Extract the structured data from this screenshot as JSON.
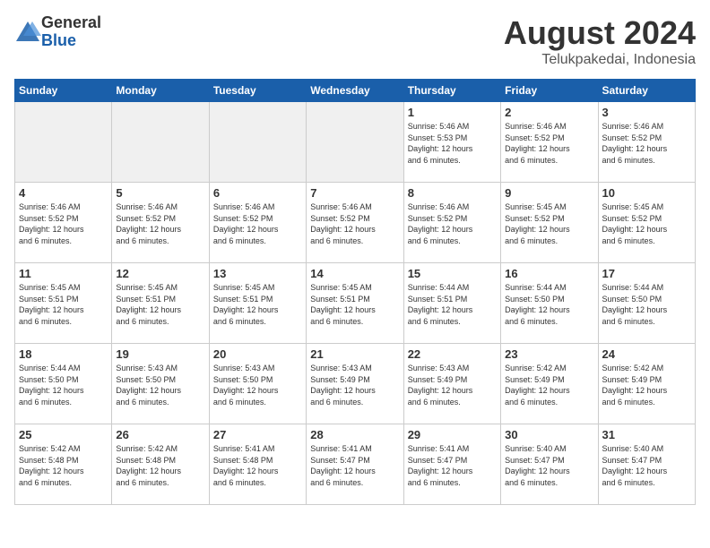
{
  "header": {
    "logo_general": "General",
    "logo_blue": "Blue",
    "title": "August 2024",
    "location": "Telukpakedai, Indonesia"
  },
  "days_of_week": [
    "Sunday",
    "Monday",
    "Tuesday",
    "Wednesday",
    "Thursday",
    "Friday",
    "Saturday"
  ],
  "weeks": [
    [
      {
        "day": "",
        "info": "",
        "shaded": true
      },
      {
        "day": "",
        "info": "",
        "shaded": true
      },
      {
        "day": "",
        "info": "",
        "shaded": true
      },
      {
        "day": "",
        "info": "",
        "shaded": true
      },
      {
        "day": "1",
        "info": "Sunrise: 5:46 AM\nSunset: 5:53 PM\nDaylight: 12 hours\nand 6 minutes."
      },
      {
        "day": "2",
        "info": "Sunrise: 5:46 AM\nSunset: 5:52 PM\nDaylight: 12 hours\nand 6 minutes."
      },
      {
        "day": "3",
        "info": "Sunrise: 5:46 AM\nSunset: 5:52 PM\nDaylight: 12 hours\nand 6 minutes."
      }
    ],
    [
      {
        "day": "4",
        "info": "Sunrise: 5:46 AM\nSunset: 5:52 PM\nDaylight: 12 hours\nand 6 minutes."
      },
      {
        "day": "5",
        "info": "Sunrise: 5:46 AM\nSunset: 5:52 PM\nDaylight: 12 hours\nand 6 minutes."
      },
      {
        "day": "6",
        "info": "Sunrise: 5:46 AM\nSunset: 5:52 PM\nDaylight: 12 hours\nand 6 minutes."
      },
      {
        "day": "7",
        "info": "Sunrise: 5:46 AM\nSunset: 5:52 PM\nDaylight: 12 hours\nand 6 minutes."
      },
      {
        "day": "8",
        "info": "Sunrise: 5:46 AM\nSunset: 5:52 PM\nDaylight: 12 hours\nand 6 minutes."
      },
      {
        "day": "9",
        "info": "Sunrise: 5:45 AM\nSunset: 5:52 PM\nDaylight: 12 hours\nand 6 minutes."
      },
      {
        "day": "10",
        "info": "Sunrise: 5:45 AM\nSunset: 5:52 PM\nDaylight: 12 hours\nand 6 minutes."
      }
    ],
    [
      {
        "day": "11",
        "info": "Sunrise: 5:45 AM\nSunset: 5:51 PM\nDaylight: 12 hours\nand 6 minutes."
      },
      {
        "day": "12",
        "info": "Sunrise: 5:45 AM\nSunset: 5:51 PM\nDaylight: 12 hours\nand 6 minutes."
      },
      {
        "day": "13",
        "info": "Sunrise: 5:45 AM\nSunset: 5:51 PM\nDaylight: 12 hours\nand 6 minutes."
      },
      {
        "day": "14",
        "info": "Sunrise: 5:45 AM\nSunset: 5:51 PM\nDaylight: 12 hours\nand 6 minutes."
      },
      {
        "day": "15",
        "info": "Sunrise: 5:44 AM\nSunset: 5:51 PM\nDaylight: 12 hours\nand 6 minutes."
      },
      {
        "day": "16",
        "info": "Sunrise: 5:44 AM\nSunset: 5:50 PM\nDaylight: 12 hours\nand 6 minutes."
      },
      {
        "day": "17",
        "info": "Sunrise: 5:44 AM\nSunset: 5:50 PM\nDaylight: 12 hours\nand 6 minutes."
      }
    ],
    [
      {
        "day": "18",
        "info": "Sunrise: 5:44 AM\nSunset: 5:50 PM\nDaylight: 12 hours\nand 6 minutes."
      },
      {
        "day": "19",
        "info": "Sunrise: 5:43 AM\nSunset: 5:50 PM\nDaylight: 12 hours\nand 6 minutes."
      },
      {
        "day": "20",
        "info": "Sunrise: 5:43 AM\nSunset: 5:50 PM\nDaylight: 12 hours\nand 6 minutes."
      },
      {
        "day": "21",
        "info": "Sunrise: 5:43 AM\nSunset: 5:49 PM\nDaylight: 12 hours\nand 6 minutes."
      },
      {
        "day": "22",
        "info": "Sunrise: 5:43 AM\nSunset: 5:49 PM\nDaylight: 12 hours\nand 6 minutes."
      },
      {
        "day": "23",
        "info": "Sunrise: 5:42 AM\nSunset: 5:49 PM\nDaylight: 12 hours\nand 6 minutes."
      },
      {
        "day": "24",
        "info": "Sunrise: 5:42 AM\nSunset: 5:49 PM\nDaylight: 12 hours\nand 6 minutes."
      }
    ],
    [
      {
        "day": "25",
        "info": "Sunrise: 5:42 AM\nSunset: 5:48 PM\nDaylight: 12 hours\nand 6 minutes."
      },
      {
        "day": "26",
        "info": "Sunrise: 5:42 AM\nSunset: 5:48 PM\nDaylight: 12 hours\nand 6 minutes."
      },
      {
        "day": "27",
        "info": "Sunrise: 5:41 AM\nSunset: 5:48 PM\nDaylight: 12 hours\nand 6 minutes."
      },
      {
        "day": "28",
        "info": "Sunrise: 5:41 AM\nSunset: 5:47 PM\nDaylight: 12 hours\nand 6 minutes."
      },
      {
        "day": "29",
        "info": "Sunrise: 5:41 AM\nSunset: 5:47 PM\nDaylight: 12 hours\nand 6 minutes."
      },
      {
        "day": "30",
        "info": "Sunrise: 5:40 AM\nSunset: 5:47 PM\nDaylight: 12 hours\nand 6 minutes."
      },
      {
        "day": "31",
        "info": "Sunrise: 5:40 AM\nSunset: 5:47 PM\nDaylight: 12 hours\nand 6 minutes."
      }
    ]
  ]
}
